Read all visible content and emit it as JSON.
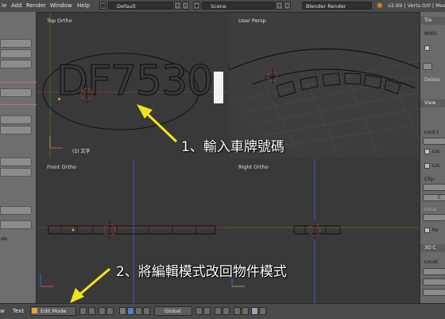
{
  "menu": {
    "file": "le",
    "add": "Add",
    "render": "Render",
    "window": "Window",
    "help": "Help"
  },
  "header": {
    "layout": "Default",
    "scene": "Scene",
    "engine": "Blender Render",
    "stats": "v2.69 | Verts:0/0 | Mesh"
  },
  "viewports": {
    "top": {
      "title": "Top Ortho",
      "footer": "(1) 文字",
      "text": "DF7530"
    },
    "persp": {
      "title": "User Persp"
    },
    "front": {
      "title": "Front Ortho"
    },
    "right": {
      "title": "Right Ortho"
    }
  },
  "annotations": {
    "step1": "1、輸入車牌號碼",
    "step2": "2、將編輯模式改回物件模式"
  },
  "right_panel": {
    "transform": "Tra",
    "nothing": "Nothi",
    "view": "View",
    "lock": "Lock t",
    "loc1": "Loc",
    "loc2": "Loc",
    "clip": "Clip:",
    "clip_val": "C",
    "local": "Local",
    "render": "Re",
    "cursor": "3D C",
    "location": "Locati",
    "delete": "Delete"
  },
  "left_panel": {
    "label": "de"
  },
  "bottombar": {
    "view": "w",
    "text": "Text",
    "mode": "Edit Mode",
    "orientation": "Global"
  },
  "colors": {
    "accent_blue": "#5680c2",
    "annotation_arrow": "#f2e31b",
    "x_axis": "#c8474d",
    "y_axis": "#6f9f3c",
    "z_axis": "#3e5ccd"
  }
}
